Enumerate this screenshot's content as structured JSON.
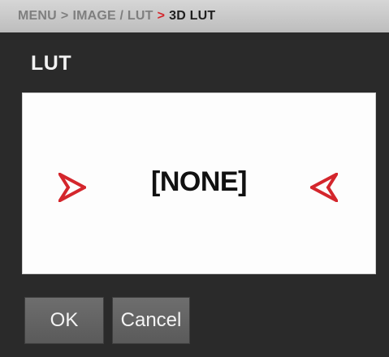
{
  "breadcrumb": {
    "menu": "MENU",
    "sep1": ">",
    "image_lut": "IMAGE / LUT",
    "sep2": ">",
    "current": "3D LUT"
  },
  "section_title": "LUT",
  "lut": {
    "value": "[NONE]",
    "prev_icon": "chevron-right-icon",
    "next_icon": "chevron-left-icon",
    "arrow_color": "#d4262c"
  },
  "buttons": {
    "ok_label": "OK",
    "cancel_label": "Cancel"
  }
}
